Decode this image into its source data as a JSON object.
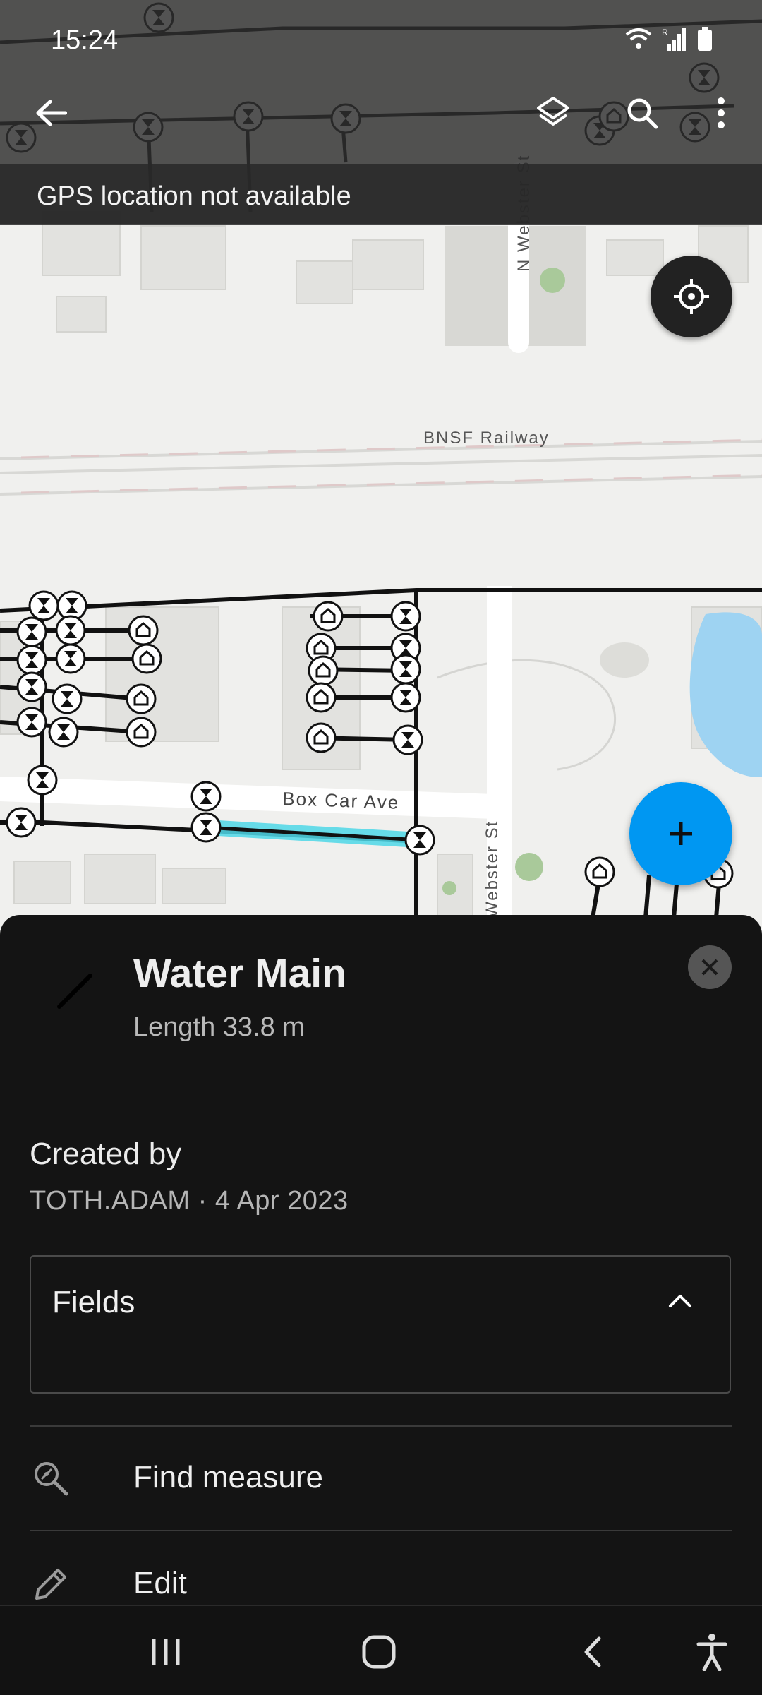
{
  "status_bar": {
    "time": "15:24"
  },
  "app_bar": {
    "back_icon": "arrow-left-icon",
    "layers_icon": "layers-icon",
    "search_icon": "search-icon",
    "more_icon": "more-vertical-icon"
  },
  "gps_banner": {
    "text": "GPS location not available"
  },
  "map": {
    "labels": {
      "railway": "BNSF Railway",
      "avenue": "Box Car Ave",
      "street_north": "N Webster St",
      "street_south": "Webster St"
    },
    "colors": {
      "highlight": "#4fd8e8",
      "water": "#9ed3f2",
      "park": "#e6e7e1"
    }
  },
  "feature": {
    "title": "Water Main",
    "subtitle": "Length 33.8 m",
    "created_label": "Created by",
    "created_value": "TOTH.ADAM · 4 Apr 2023",
    "fields_label": "Fields",
    "actions": [
      {
        "label": "Find measure",
        "icon": "find-measure-icon"
      },
      {
        "label": "Edit",
        "icon": "pencil-icon"
      }
    ]
  },
  "colors": {
    "fab": "#0097f2",
    "sheet_bg": "#141414"
  }
}
